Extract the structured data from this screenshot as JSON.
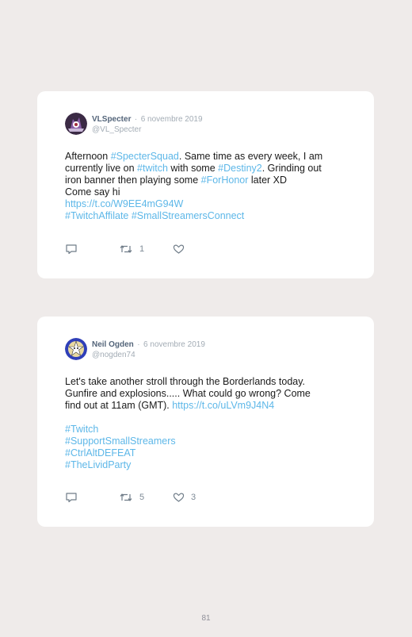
{
  "tweets": [
    {
      "author": "VLSpecter",
      "sep": "·",
      "date": "6 novembre 2019",
      "handle": "@VL_Specter",
      "lines": [
        [
          {
            "t": "Afternoon "
          },
          {
            "t": "#SpecterSquad",
            "link": true
          },
          {
            "t": ". Same time as every week, I am"
          }
        ],
        [
          {
            "t": "currently live on "
          },
          {
            "t": "#twitch",
            "link": true
          },
          {
            "t": " with some "
          },
          {
            "t": "#Destiny2",
            "link": true
          },
          {
            "t": ". Grinding out"
          }
        ],
        [
          {
            "t": "iron banner then playing some "
          },
          {
            "t": "#ForHonor",
            "link": true
          },
          {
            "t": " later XD"
          }
        ],
        [
          {
            "t": "Come say hi"
          }
        ],
        [
          {
            "t": "https://t.co/W9EE4mG94W",
            "link": true
          }
        ],
        [
          {
            "t": "#TwitchAffilate",
            "link": true
          },
          {
            "t": " "
          },
          {
            "t": "#SmallStreamersConnect",
            "link": true
          }
        ]
      ],
      "retweets": "1",
      "likes": ""
    },
    {
      "author": "Neil Ogden",
      "sep": "·",
      "date": "6 novembre 2019",
      "handle": "@nogden74",
      "lines": [
        [
          {
            "t": "Let's take another stroll through the Borderlands today."
          }
        ],
        [
          {
            "t": "Gunfire and explosions..... What could go wrong? Come"
          }
        ],
        [
          {
            "t": "find out at 11am (GMT). "
          },
          {
            "t": "https://t.co/uLVm9J4N4",
            "link": true
          }
        ],
        [],
        [
          {
            "t": "#Twitch",
            "link": true
          }
        ],
        [
          {
            "t": "#SupportSmallStreamers",
            "link": true
          }
        ],
        [
          {
            "t": "#CtrlAltDEFEAT",
            "link": true
          }
        ],
        [
          {
            "t": "#TheLividParty",
            "link": true
          }
        ]
      ],
      "retweets": "5",
      "likes": "3"
    }
  ],
  "page_number": "81"
}
